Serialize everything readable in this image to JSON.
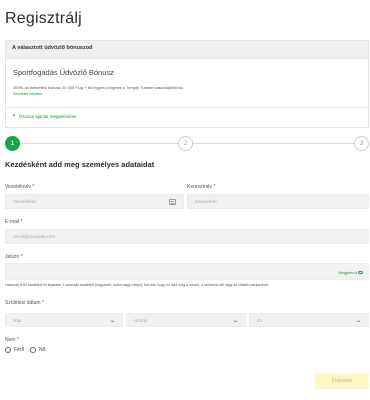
{
  "page": {
    "title": "Regisztrálj"
  },
  "bonus": {
    "header": "A választott üdvözlő bónuszod",
    "name": "Sportfogadás Üdvözlő Bónusz",
    "description": "100%-os befizetési bónusz 20 000 Ft-ig + 60 ingyen pörgetés a Temple Tumble kaszinójátékhoz.",
    "details_link": "Részletek letöltése",
    "all_offers_link": "Összes ajánlat megtekintése"
  },
  "steps": {
    "items": [
      "1",
      "2",
      "3"
    ],
    "active_index": 0
  },
  "form": {
    "section_title": "Kezdésként add meg személyes adataidat",
    "last_name": {
      "label": "Vezetéknév *",
      "placeholder": "Vezetéknév"
    },
    "first_name": {
      "label": "Keresztnév *",
      "placeholder": "Keresztnév"
    },
    "email": {
      "label": "E-mail *",
      "placeholder": "email@example.com"
    },
    "password": {
      "label": "Jelszó *",
      "show_label": "Megjelenít",
      "hint": "Használj 8-60 karaktert és legalább 1 speciális karaktert (nagybetű, szám vagy írásjel). Kérünk, hogy ne add meg a neved, a születési idő vagy az Unibet márkanevet."
    },
    "birth_date": {
      "label": "Születési dátum *",
      "day_placeholder": "Nap",
      "month_placeholder": "Hónap",
      "year_placeholder": "Év"
    },
    "gender": {
      "label": "Nem *",
      "options": [
        "Férfi",
        "Nő"
      ]
    },
    "continue_label": "Folytatás"
  },
  "colors": {
    "accent": "#16a34a",
    "link": "#1a9b3a",
    "button_bg": "#fdf6c7"
  }
}
